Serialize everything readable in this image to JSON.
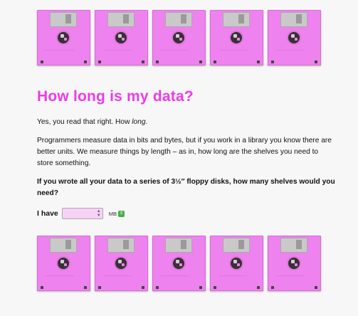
{
  "page": {
    "title": "How long is my data?",
    "intro_lead": "Yes, you read that right. How ",
    "intro_emphasis": "long",
    "intro_tail": ".",
    "paragraph": "Programmers measure data in bits and bytes, but if you work in a library you know there are better units. We measure things by length – as in, how long are the shelves you need to store something.",
    "question": "If you wrote all your data to a series of 3½″ floppy disks, how many shelves would you need?",
    "have_label": "I have",
    "amount": {
      "value": "",
      "placeholder": ""
    },
    "unit": {
      "selected": "MB"
    }
  },
  "decor": {
    "disk_color": "#ee82ee",
    "heading_color": "#ee3be6",
    "top_row_count": 5,
    "bottom_row_count": 5
  }
}
